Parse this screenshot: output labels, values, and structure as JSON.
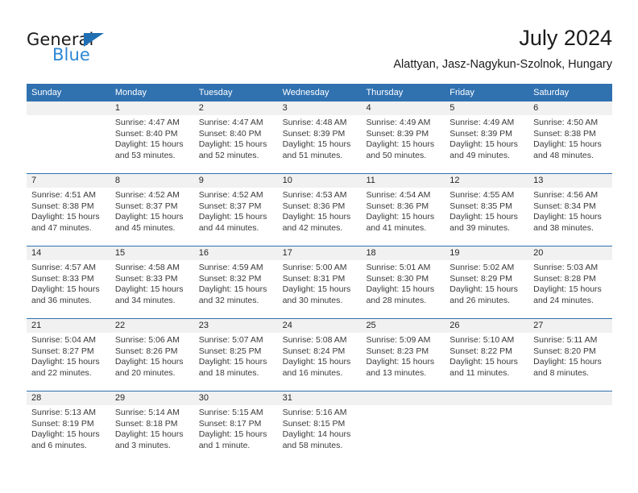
{
  "brand": {
    "name_part1": "General",
    "name_part2": "Blue",
    "triangle_color": "#1f6fb2",
    "blue_color": "#2d87d4"
  },
  "header": {
    "title": "July 2024",
    "subtitle": "Alattyan, Jasz-Nagykun-Szolnok, Hungary"
  },
  "theme": {
    "header_blue": "#3071b0",
    "day_band_gray": "#f1f1f1"
  },
  "weekdays": [
    "Sunday",
    "Monday",
    "Tuesday",
    "Wednesday",
    "Thursday",
    "Friday",
    "Saturday"
  ],
  "weeks": [
    {
      "days": [
        {
          "num": "",
          "lines": []
        },
        {
          "num": "1",
          "lines": [
            "Sunrise: 4:47 AM",
            "Sunset: 8:40 PM",
            "Daylight: 15 hours",
            "and 53 minutes."
          ]
        },
        {
          "num": "2",
          "lines": [
            "Sunrise: 4:47 AM",
            "Sunset: 8:40 PM",
            "Daylight: 15 hours",
            "and 52 minutes."
          ]
        },
        {
          "num": "3",
          "lines": [
            "Sunrise: 4:48 AM",
            "Sunset: 8:39 PM",
            "Daylight: 15 hours",
            "and 51 minutes."
          ]
        },
        {
          "num": "4",
          "lines": [
            "Sunrise: 4:49 AM",
            "Sunset: 8:39 PM",
            "Daylight: 15 hours",
            "and 50 minutes."
          ]
        },
        {
          "num": "5",
          "lines": [
            "Sunrise: 4:49 AM",
            "Sunset: 8:39 PM",
            "Daylight: 15 hours",
            "and 49 minutes."
          ]
        },
        {
          "num": "6",
          "lines": [
            "Sunrise: 4:50 AM",
            "Sunset: 8:38 PM",
            "Daylight: 15 hours",
            "and 48 minutes."
          ]
        }
      ]
    },
    {
      "days": [
        {
          "num": "7",
          "lines": [
            "Sunrise: 4:51 AM",
            "Sunset: 8:38 PM",
            "Daylight: 15 hours",
            "and 47 minutes."
          ]
        },
        {
          "num": "8",
          "lines": [
            "Sunrise: 4:52 AM",
            "Sunset: 8:37 PM",
            "Daylight: 15 hours",
            "and 45 minutes."
          ]
        },
        {
          "num": "9",
          "lines": [
            "Sunrise: 4:52 AM",
            "Sunset: 8:37 PM",
            "Daylight: 15 hours",
            "and 44 minutes."
          ]
        },
        {
          "num": "10",
          "lines": [
            "Sunrise: 4:53 AM",
            "Sunset: 8:36 PM",
            "Daylight: 15 hours",
            "and 42 minutes."
          ]
        },
        {
          "num": "11",
          "lines": [
            "Sunrise: 4:54 AM",
            "Sunset: 8:36 PM",
            "Daylight: 15 hours",
            "and 41 minutes."
          ]
        },
        {
          "num": "12",
          "lines": [
            "Sunrise: 4:55 AM",
            "Sunset: 8:35 PM",
            "Daylight: 15 hours",
            "and 39 minutes."
          ]
        },
        {
          "num": "13",
          "lines": [
            "Sunrise: 4:56 AM",
            "Sunset: 8:34 PM",
            "Daylight: 15 hours",
            "and 38 minutes."
          ]
        }
      ]
    },
    {
      "days": [
        {
          "num": "14",
          "lines": [
            "Sunrise: 4:57 AM",
            "Sunset: 8:33 PM",
            "Daylight: 15 hours",
            "and 36 minutes."
          ]
        },
        {
          "num": "15",
          "lines": [
            "Sunrise: 4:58 AM",
            "Sunset: 8:33 PM",
            "Daylight: 15 hours",
            "and 34 minutes."
          ]
        },
        {
          "num": "16",
          "lines": [
            "Sunrise: 4:59 AM",
            "Sunset: 8:32 PM",
            "Daylight: 15 hours",
            "and 32 minutes."
          ]
        },
        {
          "num": "17",
          "lines": [
            "Sunrise: 5:00 AM",
            "Sunset: 8:31 PM",
            "Daylight: 15 hours",
            "and 30 minutes."
          ]
        },
        {
          "num": "18",
          "lines": [
            "Sunrise: 5:01 AM",
            "Sunset: 8:30 PM",
            "Daylight: 15 hours",
            "and 28 minutes."
          ]
        },
        {
          "num": "19",
          "lines": [
            "Sunrise: 5:02 AM",
            "Sunset: 8:29 PM",
            "Daylight: 15 hours",
            "and 26 minutes."
          ]
        },
        {
          "num": "20",
          "lines": [
            "Sunrise: 5:03 AM",
            "Sunset: 8:28 PM",
            "Daylight: 15 hours",
            "and 24 minutes."
          ]
        }
      ]
    },
    {
      "days": [
        {
          "num": "21",
          "lines": [
            "Sunrise: 5:04 AM",
            "Sunset: 8:27 PM",
            "Daylight: 15 hours",
            "and 22 minutes."
          ]
        },
        {
          "num": "22",
          "lines": [
            "Sunrise: 5:06 AM",
            "Sunset: 8:26 PM",
            "Daylight: 15 hours",
            "and 20 minutes."
          ]
        },
        {
          "num": "23",
          "lines": [
            "Sunrise: 5:07 AM",
            "Sunset: 8:25 PM",
            "Daylight: 15 hours",
            "and 18 minutes."
          ]
        },
        {
          "num": "24",
          "lines": [
            "Sunrise: 5:08 AM",
            "Sunset: 8:24 PM",
            "Daylight: 15 hours",
            "and 16 minutes."
          ]
        },
        {
          "num": "25",
          "lines": [
            "Sunrise: 5:09 AM",
            "Sunset: 8:23 PM",
            "Daylight: 15 hours",
            "and 13 minutes."
          ]
        },
        {
          "num": "26",
          "lines": [
            "Sunrise: 5:10 AM",
            "Sunset: 8:22 PM",
            "Daylight: 15 hours",
            "and 11 minutes."
          ]
        },
        {
          "num": "27",
          "lines": [
            "Sunrise: 5:11 AM",
            "Sunset: 8:20 PM",
            "Daylight: 15 hours",
            "and 8 minutes."
          ]
        }
      ]
    },
    {
      "days": [
        {
          "num": "28",
          "lines": [
            "Sunrise: 5:13 AM",
            "Sunset: 8:19 PM",
            "Daylight: 15 hours",
            "and 6 minutes."
          ]
        },
        {
          "num": "29",
          "lines": [
            "Sunrise: 5:14 AM",
            "Sunset: 8:18 PM",
            "Daylight: 15 hours",
            "and 3 minutes."
          ]
        },
        {
          "num": "30",
          "lines": [
            "Sunrise: 5:15 AM",
            "Sunset: 8:17 PM",
            "Daylight: 15 hours",
            "and 1 minute."
          ]
        },
        {
          "num": "31",
          "lines": [
            "Sunrise: 5:16 AM",
            "Sunset: 8:15 PM",
            "Daylight: 14 hours",
            "and 58 minutes."
          ]
        },
        {
          "num": "",
          "lines": []
        },
        {
          "num": "",
          "lines": []
        },
        {
          "num": "",
          "lines": []
        }
      ]
    }
  ]
}
